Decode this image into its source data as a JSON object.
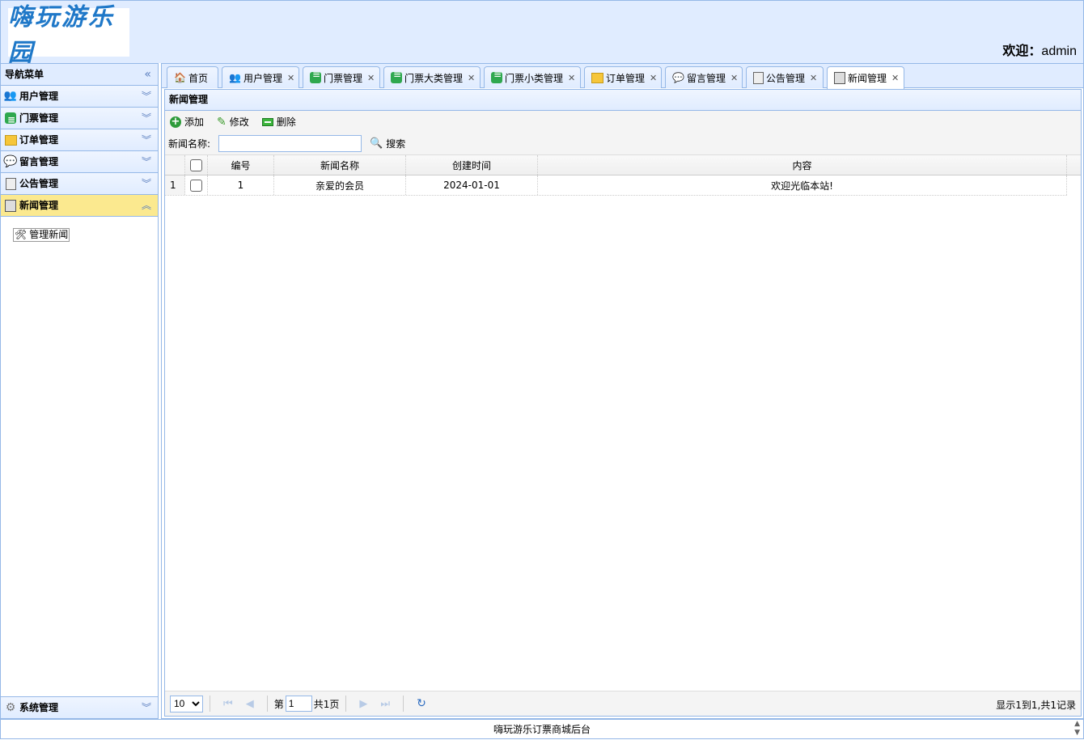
{
  "header": {
    "logo_text": "嗨玩游乐园",
    "welcome_label": "欢迎：",
    "username": "admin"
  },
  "sidebar": {
    "title": "导航菜单",
    "items": [
      {
        "label": "用户管理"
      },
      {
        "label": "门票管理"
      },
      {
        "label": "订单管理"
      },
      {
        "label": "留言管理"
      },
      {
        "label": "公告管理"
      },
      {
        "label": "新闻管理"
      }
    ],
    "active_submenu": {
      "label": "管理新闻"
    },
    "bottom": {
      "label": "系统管理"
    }
  },
  "tabs": [
    {
      "label": "首页"
    },
    {
      "label": "用户管理"
    },
    {
      "label": "门票管理"
    },
    {
      "label": "门票大类管理"
    },
    {
      "label": "门票小类管理"
    },
    {
      "label": "订单管理"
    },
    {
      "label": "留言管理"
    },
    {
      "label": "公告管理"
    },
    {
      "label": "新闻管理"
    }
  ],
  "panel": {
    "title": "新闻管理",
    "toolbar": {
      "add": "添加",
      "edit": "修改",
      "delete": "删除"
    },
    "search": {
      "label": "新闻名称:",
      "value": "",
      "button": "搜索"
    },
    "columns": [
      "编号",
      "新闻名称",
      "创建时间",
      "内容"
    ],
    "rows": [
      {
        "rownum": "1",
        "id": "1",
        "name": "亲爱的会员",
        "created": "2024-01-01",
        "content": "欢迎光临本站!"
      }
    ],
    "pager": {
      "page_size": "10",
      "page_prefix": "第",
      "page": "1",
      "total_pages": "共1页",
      "info": "显示1到1,共1记录"
    }
  },
  "footer": {
    "text": "嗨玩游乐订票商城后台"
  }
}
